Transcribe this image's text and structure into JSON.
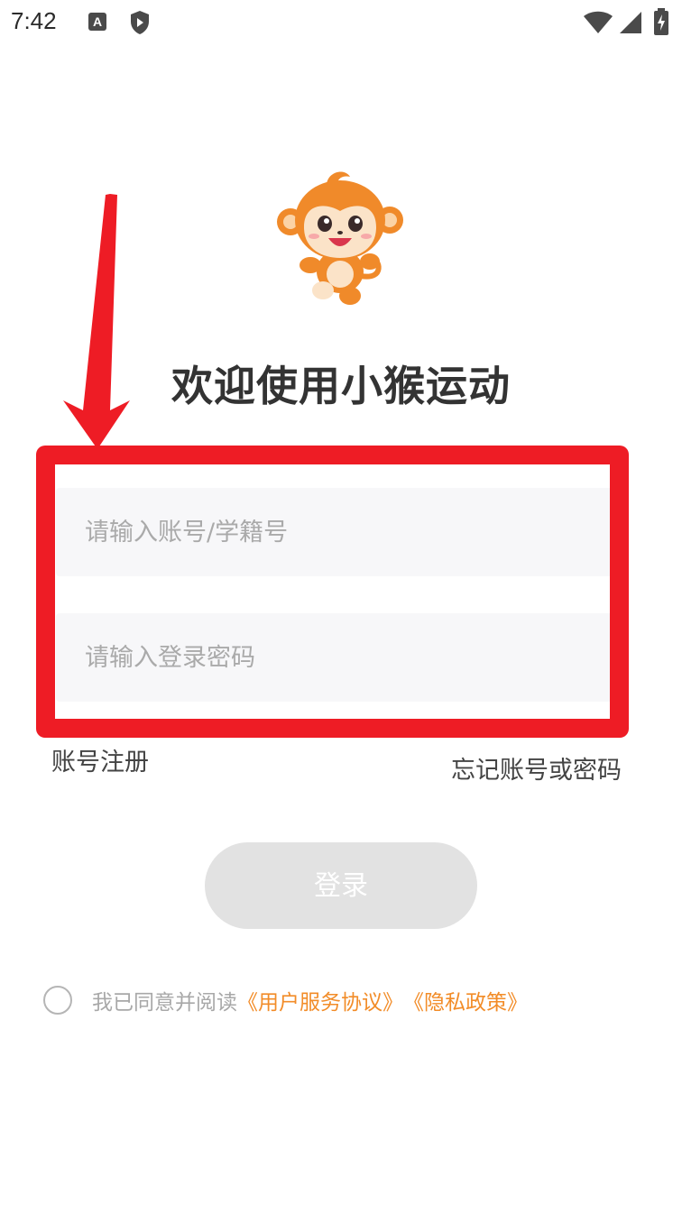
{
  "status_bar": {
    "time": "7:42",
    "icons": [
      "a-badge-icon",
      "shield-icon",
      "wifi-icon",
      "signal-icon",
      "battery-charging-icon"
    ]
  },
  "mascot": {
    "name": "monkey-mascot-icon"
  },
  "title": "欢迎使用小猴运动",
  "account_input": {
    "placeholder": "请输入账号/学籍号",
    "value": ""
  },
  "password_input": {
    "placeholder": "请输入登录密码",
    "value": ""
  },
  "register_link": "账号注册",
  "forgot_link": "忘记账号或密码",
  "login_button": "登录",
  "agreement": {
    "checked": false,
    "prefix": "我已同意并阅读",
    "terms": "《用户服务协议》",
    "privacy": "《隐私政策》"
  },
  "colors": {
    "annotation_red": "#ee1c25",
    "link_orange": "#f28c28",
    "button_disabled": "#e2e2e2"
  }
}
